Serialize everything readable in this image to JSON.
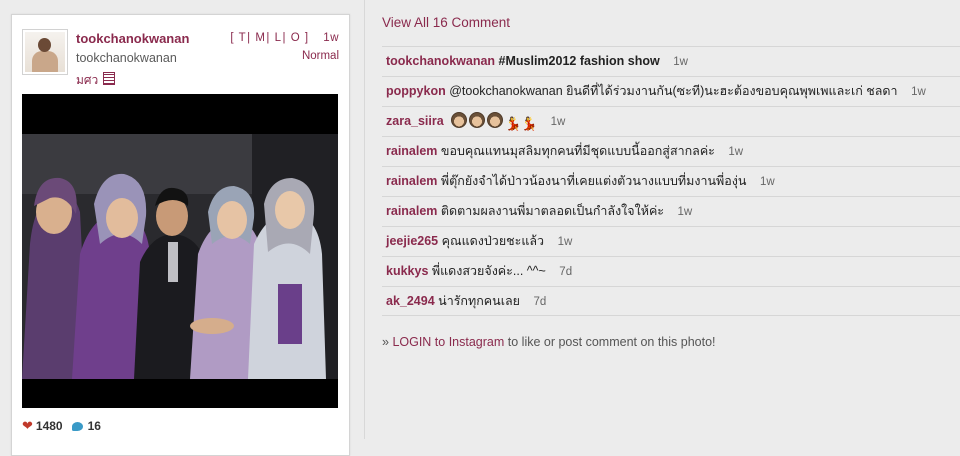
{
  "post": {
    "username": "tookchanokwanan",
    "fullname": "tookchanokwanan",
    "location": "มศว",
    "size_links": [
      "T",
      "M",
      "L",
      "O"
    ],
    "time": "1w",
    "filter": "Normal",
    "likes": "1480",
    "comments_count": "16"
  },
  "comments_section": {
    "view_all_label": "View All 16 Comment",
    "items": [
      {
        "user": "tookchanokwanan",
        "text": "#Muslim2012 fashion show",
        "time": "1w"
      },
      {
        "user": "poppykon",
        "text": "@tookchanokwanan ยินดีที่ได้ร่วมงานกัน(ซะที)นะฮะต้องขอบคุณพุพเพและเก่ ชลดา",
        "time": "1w"
      },
      {
        "user": "zara_siira",
        "text": "",
        "time": "1w",
        "emojis": [
          "face",
          "face",
          "face",
          "dancer",
          "dancer"
        ]
      },
      {
        "user": "rainalem",
        "text": "ขอบคุณแทนมุสลิมทุกคนที่มีชุดแบบนี้ออกสู่สากลค่ะ",
        "time": "1w"
      },
      {
        "user": "rainalem",
        "text": "พี่ตุ๊กยังจำได้ป่าวน้องนาที่เคยแต่งตัวนางแบบที่มงานพี่องุ่น",
        "time": "1w"
      },
      {
        "user": "rainalem",
        "text": "ติดตามผลงานพี่มาตลอดเป็นกำลังใจให้ค่ะ",
        "time": "1w"
      },
      {
        "user": "jeejie265",
        "text": "คุณแดงป่วยชะแล้ว",
        "time": "1w"
      },
      {
        "user": "kukkys",
        "text": "พี่แดงสวยจังค่ะ... ^^~",
        "time": "7d"
      },
      {
        "user": "ak_2494",
        "text": "น่ารักทุกคนเลย",
        "time": "7d"
      }
    ],
    "login_prefix": "» ",
    "login_link": "LOGIN to Instagram",
    "login_suffix": " to like or post comment on this photo!"
  },
  "colors": {
    "brand": "#8a2a4d",
    "background": "#ececec"
  }
}
